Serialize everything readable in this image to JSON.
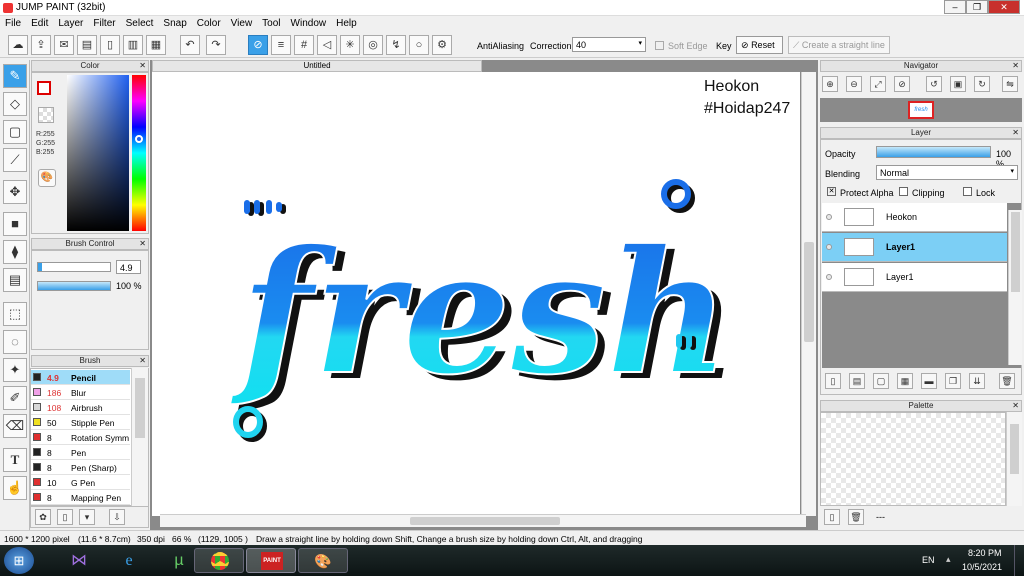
{
  "app": {
    "title": "JUMP PAINT (32bit)"
  },
  "menu": [
    "File",
    "Edit",
    "Layer",
    "Filter",
    "Select",
    "Snap",
    "Color",
    "View",
    "Tool",
    "Window",
    "Help"
  ],
  "toolbar": {
    "antialiasing_label": "AntiAliasing",
    "correction_label": "Correction",
    "correction_value": "40",
    "soft_edge_label": "Soft Edge",
    "key_label": "Key",
    "reset_label": "Reset",
    "straight_line_label": "Create a straight line"
  },
  "color_panel": {
    "title": "Color",
    "r": "R:255",
    "g": "G:255",
    "b": "B:255"
  },
  "brush_control": {
    "title": "Brush Control",
    "size": "4.9",
    "opacity": "100 %",
    "size_fraction": 0.06,
    "opacity_fraction": 1.0
  },
  "brush_panel": {
    "title": "Brush",
    "items": [
      {
        "size": "4.9",
        "name": "Pencil",
        "color": "#222222",
        "selected": true
      },
      {
        "size": "186",
        "name": "Blur",
        "color": "#f0a0e8"
      },
      {
        "size": "108",
        "name": "Airbrush",
        "color": "#d8d8d8"
      },
      {
        "size": "50",
        "name": "Stipple Pen",
        "color": "#f0e020"
      },
      {
        "size": "8",
        "name": "Rotation Symm",
        "color": "#e03030"
      },
      {
        "size": "8",
        "name": "Pen",
        "color": "#222222"
      },
      {
        "size": "8",
        "name": "Pen (Sharp)",
        "color": "#222222"
      },
      {
        "size": "10",
        "name": "G Pen",
        "color": "#e03030"
      },
      {
        "size": "8",
        "name": "Mapping Pen",
        "color": "#e03030"
      }
    ]
  },
  "canvas": {
    "tab": "Untitled",
    "text_main": "fresh",
    "watermark_line1": "Heokon",
    "watermark_line2": "#Hoidap247"
  },
  "navigator": {
    "title": "Navigator"
  },
  "layer_panel": {
    "title": "Layer",
    "opacity_label": "Opacity",
    "opacity_value": "100 %",
    "blending_label": "Blending",
    "blending_value": "Normal",
    "protect_alpha": "Protect Alpha",
    "clipping": "Clipping",
    "lock": "Lock",
    "layers": [
      {
        "name": "Heokon",
        "selected": false
      },
      {
        "name": "Layer1",
        "selected": true
      },
      {
        "name": "Layer1",
        "selected": false
      }
    ]
  },
  "palette": {
    "title": "Palette",
    "footer": "---"
  },
  "status": {
    "size": "1600 * 1200 pixel",
    "cm": "(11.6 * 8.7cm)",
    "dpi": "350 dpi",
    "zoom": "66 %",
    "coords": "(1129, 1005 )",
    "hint": "Draw a straight line by holding down Shift, Change a brush size by holding down Ctrl, Alt, and dragging"
  },
  "taskbar": {
    "lang": "EN",
    "time": "8:20 PM",
    "date": "10/5/2021"
  },
  "colors": {
    "accent": "#3aa0e8",
    "grad_top": "#1e6fe8",
    "grad_bottom": "#18d8f0",
    "selected_layer": "#7ccff5"
  }
}
